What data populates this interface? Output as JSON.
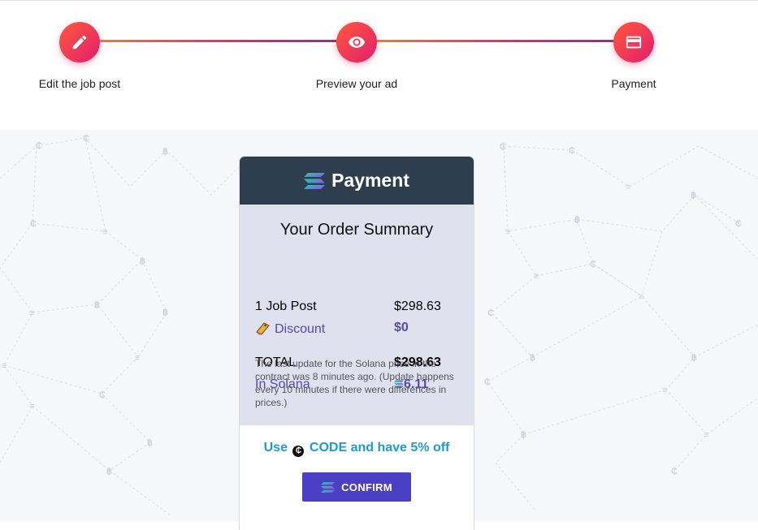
{
  "steps": [
    {
      "label": "Edit the job post",
      "icon": "pencil-icon"
    },
    {
      "label": "Preview your ad",
      "icon": "eye-icon"
    },
    {
      "label": "Payment",
      "icon": "credit-card-icon"
    }
  ],
  "card": {
    "title": "Payment",
    "summary_title": "Your Order Summary",
    "job_post_label": "1 Job Post",
    "job_post_value": "$298.63",
    "discount_label": "Discount",
    "discount_value": "$0",
    "total_label": "TOTAL",
    "total_value": "$298.63",
    "solana_label": "In Solana",
    "solana_value": "6.11",
    "note": "The last update for the Solana price in the contract was 8 minutes ago. (Update happens every 10 minutes if there were differences in prices.)",
    "promo_prefix": "Use",
    "promo_suffix": "CODE and have 5% off",
    "confirm_label": "CONFIRM"
  },
  "colors": {
    "accent_gradient_start": "#ff5a3c",
    "accent_gradient_end": "#e11d6e",
    "header_bg": "#2f3e4e",
    "summary_bg": "#e0e1ef",
    "purple_text": "#5249b7",
    "promo_blue": "#1e9bd7",
    "confirm_bg": "#4b3fc4"
  }
}
